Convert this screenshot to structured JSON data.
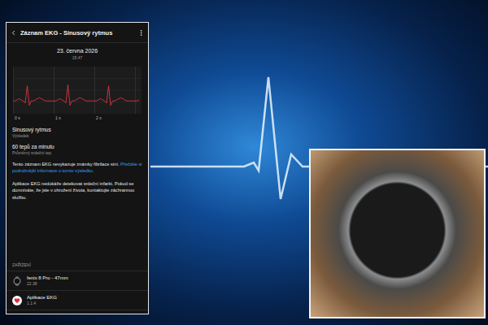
{
  "header": {
    "title": "Záznam EKG - Sinusový rytmus"
  },
  "record": {
    "date": "23. června 2026",
    "time": "15:47"
  },
  "chart": {
    "ticks": [
      "0 s",
      "1 s",
      "2 s"
    ],
    "series": [
      {
        "name": "EKG",
        "values": [
          0,
          0,
          0.05,
          0.1,
          0.05,
          0,
          -0.1,
          0.7,
          -0.2,
          0,
          0,
          0.05,
          0.1,
          0.15,
          0.1,
          0.05,
          0,
          0,
          0,
          0,
          0,
          0,
          0.05,
          0.1,
          0.05,
          0,
          -0.1,
          0.75,
          -0.2,
          0,
          0,
          0.05,
          0.1,
          0.15,
          0.1,
          0.05,
          0,
          0,
          0,
          0,
          0,
          0,
          0.05,
          0.1,
          0.05,
          0,
          -0.1,
          0.7,
          -0.2,
          0,
          0,
          0.05,
          0.1,
          0.15,
          0.1,
          0.05,
          0,
          0,
          0,
          0,
          0,
          0,
          0.05
        ]
      }
    ]
  },
  "results": [
    {
      "value": "Sinusový rytmus",
      "label": "Výsledek"
    },
    {
      "value": "60 tepů za minutu",
      "label": "Průměrný srdeční tep."
    }
  ],
  "notice": {
    "text": "Tento záznam EKG nevykazuje známky fibrilace síní.",
    "link": "Přečtěte si podrobnější informace o tomto výsledku."
  },
  "disclaimer": "Aplikace EKG nedokáže detekovat srdeční infarkt. Pokud se domníváte, že jste v ohrožení života, kontaktujte záchrannou službu.",
  "devices": {
    "heading": "ZAŘÍZENÍ",
    "items": [
      {
        "name": "fenix 8 Pro - 47mm",
        "version": "22.38",
        "kind": "watch"
      },
      {
        "name": "Aplikace EKG",
        "version": "1.1.4",
        "kind": "app"
      }
    ]
  }
}
